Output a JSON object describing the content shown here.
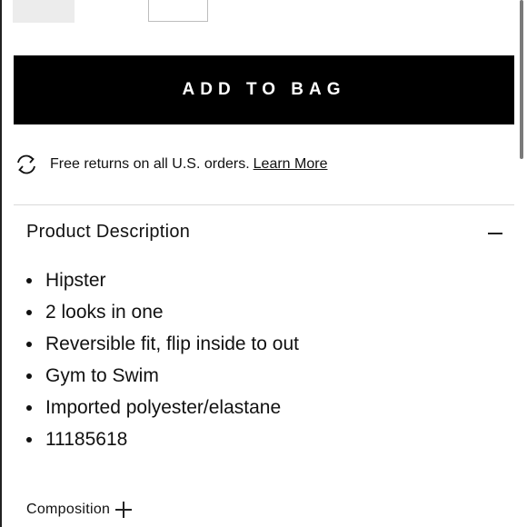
{
  "actions": {
    "add_to_bag_label": "ADD TO BAG"
  },
  "returns": {
    "text": "Free returns on all U.S. orders.",
    "link_label": "Learn More",
    "icon": "refresh-arrows-icon"
  },
  "product_description": {
    "title": "Product Description",
    "toggle_icon": "minus-icon",
    "items": [
      "Hipster",
      "2 looks in one",
      "Reversible fit,  flip inside to out",
      "Gym to Swim",
      "Imported polyester/elastane",
      "11185618"
    ]
  },
  "composition": {
    "label": "Composition",
    "toggle_icon": "plus-icon"
  },
  "colors": {
    "button_bg": "#000000",
    "button_text": "#ffffff",
    "divider": "#d9d9d9"
  }
}
